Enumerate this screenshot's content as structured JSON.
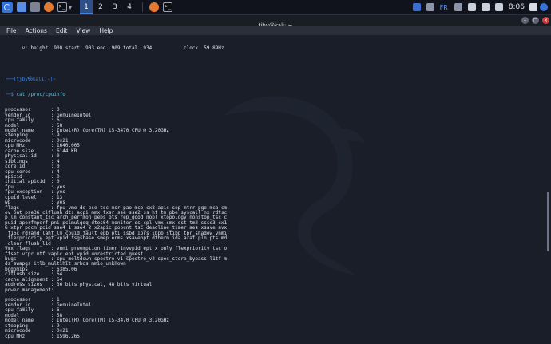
{
  "taskbar": {
    "workspaces": [
      "1",
      "2",
      "3",
      "4"
    ],
    "active_workspace": "1",
    "language": "FR",
    "clock": "8:06",
    "launcher_icons": [
      "kali-menu-icon",
      "desktop-icon",
      "files-icon",
      "firefox-icon",
      "terminal-icon"
    ]
  },
  "window": {
    "title": "tjby@kali: ~"
  },
  "menu": [
    "File",
    "Actions",
    "Edit",
    "View",
    "Help"
  ],
  "terminal": {
    "prev_line": "      v: height  900 start  903 end  909 total  934           clock  59.89Hz",
    "prompt_top": "┌──(tjby㉿kali)-[~]",
    "prompt_cmd_prefix": "└─$ ",
    "command": "cat /proc/cpuinfo",
    "cpuinfo": [
      "processor\t: 0",
      "vendor_id\t: GenuineIntel",
      "cpu family\t: 6",
      "model\t\t: 58",
      "model name\t: Intel(R) Core(TM) i5-3470 CPU @ 3.20GHz",
      "stepping\t: 9",
      "microcode\t: 0×21",
      "cpu MHz\t\t: 1640.005",
      "cache size\t: 6144 KB",
      "physical id\t: 0",
      "siblings\t: 4",
      "core id\t\t: 0",
      "cpu cores\t: 4",
      "apicid\t\t: 0",
      "initial apicid\t: 0",
      "fpu\t\t: yes",
      "fpu_exception\t: yes",
      "cpuid level\t: 13",
      "wp\t\t: yes",
      "flags\t\t: fpu vme de pse tsc msr pae mce cx8 apic sep mtrr pge mca cm",
      "ov pat pse36 clflush dts acpi mmx fxsr sse sse2 ss ht tm pbe syscall nx rdtsc",
      "p lm constant_tsc arch_perfmon pebs bts rep_good nopl xtopology nonstop_tsc c",
      "puid aperfmperf pni pclmulqdq dtes64 monitor ds_cpl vmx smx est tm2 ssse3 cx1",
      "6 xtpr pdcm pcid sse4_1 sse4_2 x2apic popcnt tsc_deadline_timer aes xsave avx",
      " f16c rdrand lahf_lm cpuid_fault epb pti ssbd ibrs ibpb stibp tpr_shadow vnmi",
      " flexpriority ept vpid fsgsbase smep erms xsaveopt dtherm ida arat pln pts md",
      "_clear flush_l1d",
      "vmx flags\t: vnmi preemption_timer invvpid ept_x_only flexpriority tsc_o",
      "ffset vtpr mtf vapic ept vpid unrestricted_guest",
      "bugs\t\t: cpu_meltdown spectre_v1 spectre_v2 spec_store_bypass l1tf m",
      "ds swapgs itlb_multihit srbds mmio_unknown",
      "bogomips\t: 6385.06",
      "clflush size\t: 64",
      "cache_alignment\t: 64",
      "address sizes\t: 36 bits physical, 48 bits virtual",
      "power management:",
      "",
      "processor\t: 1",
      "vendor_id\t: GenuineIntel",
      "cpu family\t: 6",
      "model\t\t: 58",
      "model name\t: Intel(R) Core(TM) i5-3470 CPU @ 3.20GHz",
      "stepping\t: 9",
      "microcode\t: 0×21",
      "cpu MHz\t\t: 1596.265"
    ]
  }
}
